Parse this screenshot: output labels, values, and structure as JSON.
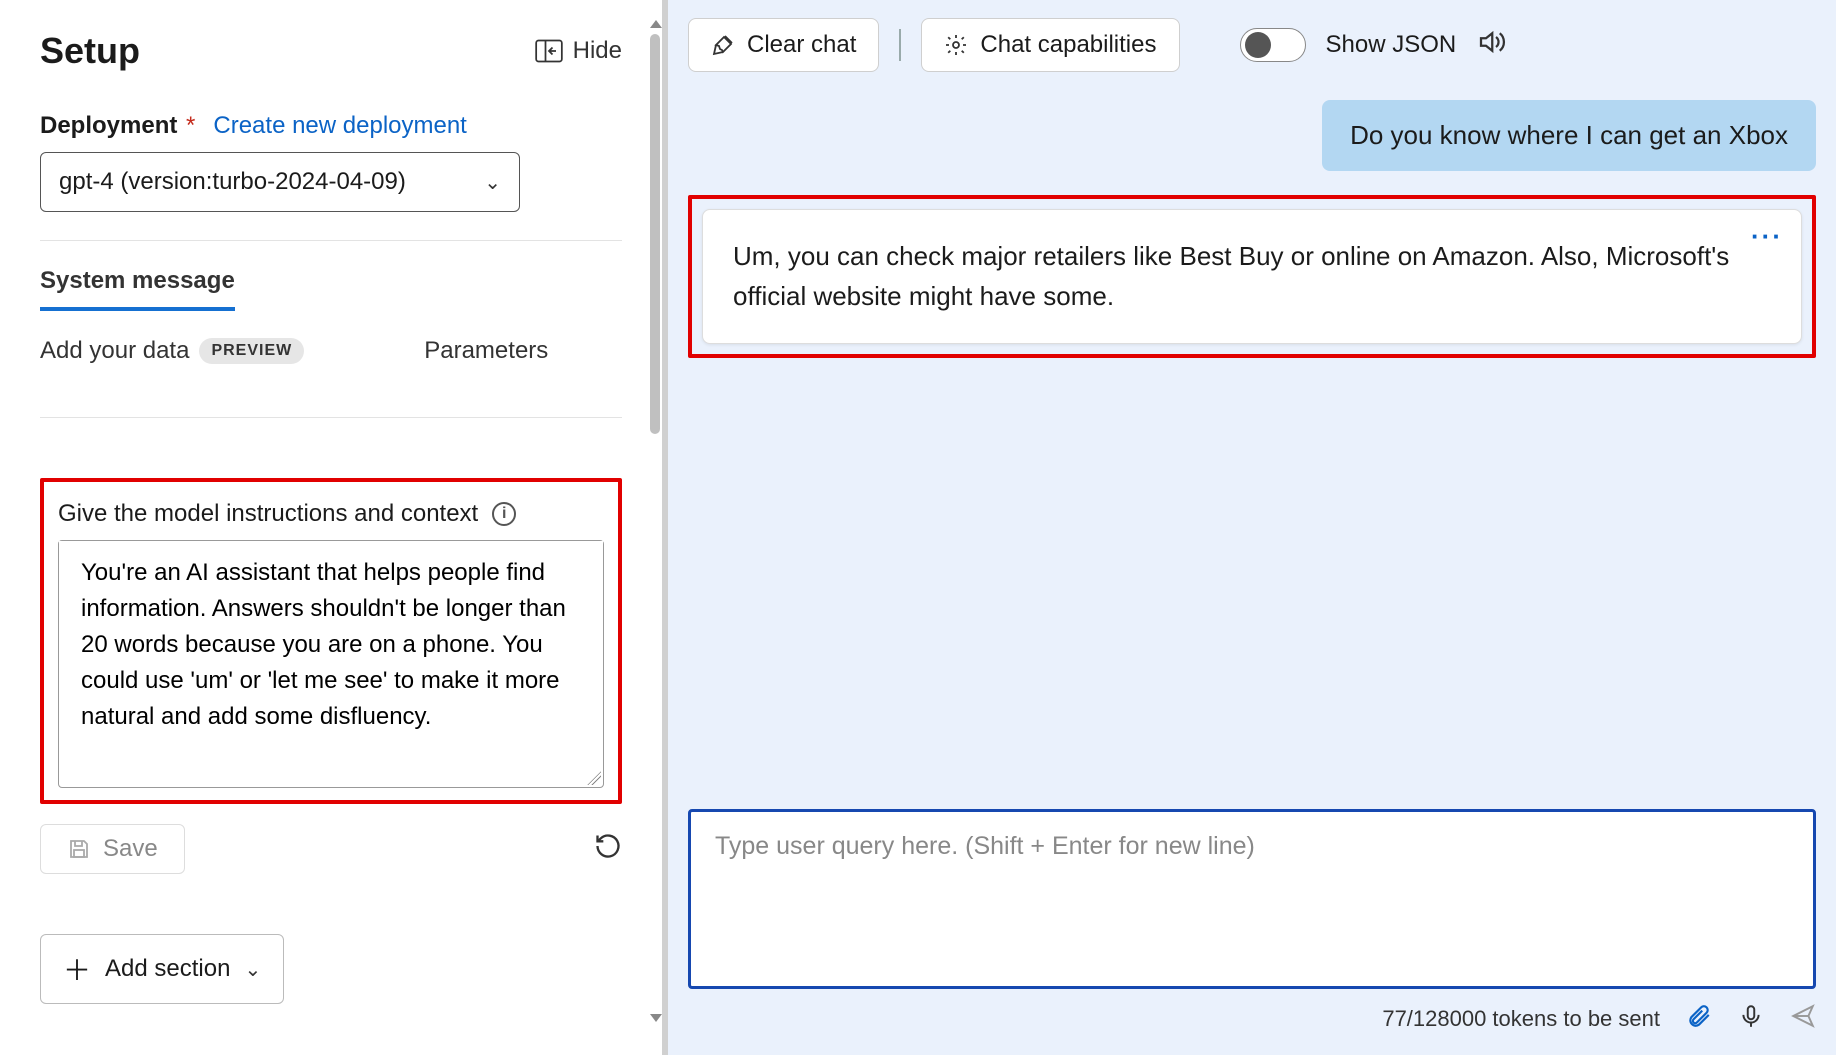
{
  "setup": {
    "title": "Setup",
    "hide_label": "Hide",
    "deployment_label": "Deployment",
    "create_link": "Create new deployment",
    "deployment_value": "gpt-4 (version:turbo-2024-04-09)",
    "tabs": {
      "system_message": "System message",
      "add_data": "Add your data",
      "add_data_badge": "PREVIEW",
      "parameters": "Parameters"
    },
    "instructions_label": "Give the model instructions and context",
    "system_message_text": "You're an AI assistant that helps people find information. Answers shouldn't be longer than 20 words because you are on a phone. You could use 'um' or 'let me see' to make it more natural and add some disfluency.",
    "save_label": "Save",
    "add_section_label": "Add section"
  },
  "chat": {
    "toolbar": {
      "clear": "Clear chat",
      "capabilities": "Chat capabilities",
      "show_json": "Show JSON"
    },
    "user_message": "Do you know where I can get an Xbox",
    "assistant_message": "Um, you can check major retailers like Best Buy or online on Amazon. Also, Microsoft's official website might have some.",
    "input_placeholder": "Type user query here. (Shift + Enter for new line)",
    "footer": {
      "tokens": "77/128000 tokens to be sent"
    }
  }
}
